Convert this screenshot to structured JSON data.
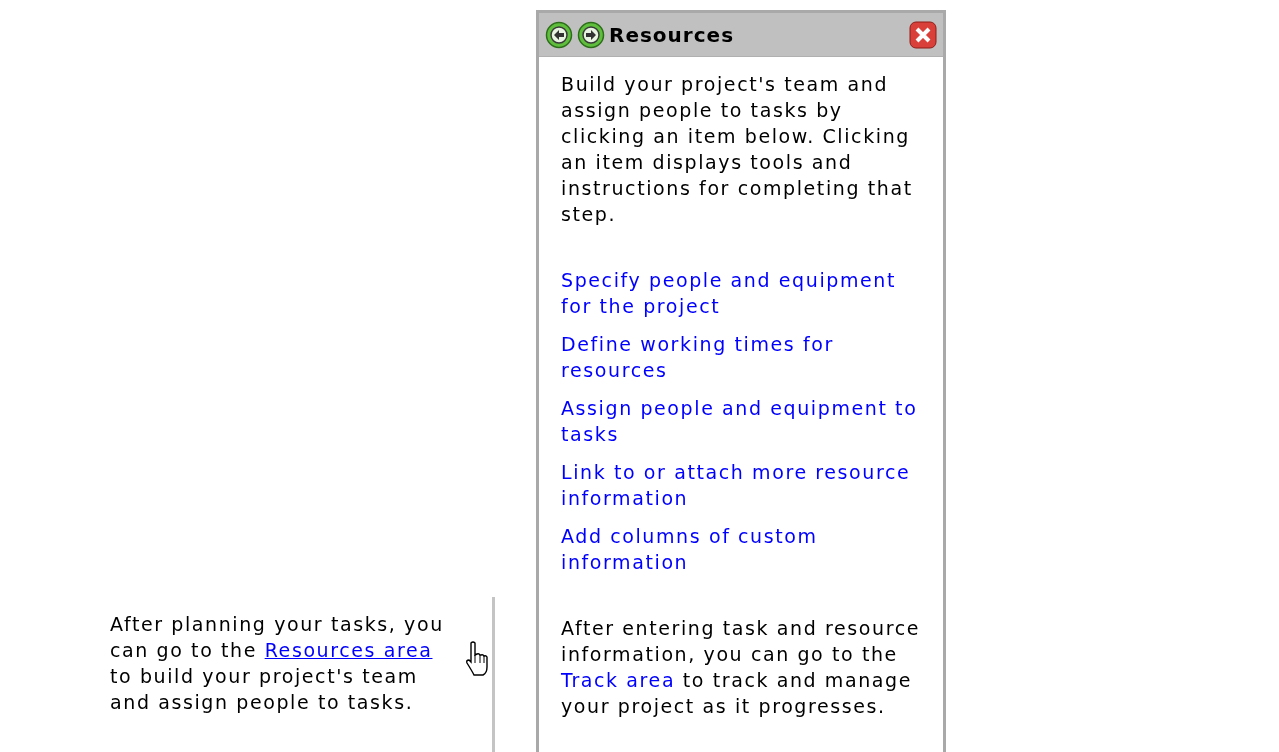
{
  "note": {
    "text_before": "After planning your tasks, you can go to the",
    "link": "Resources area",
    "text_after": "to build your project's team and assign people to tasks."
  },
  "panel": {
    "title": "Resources",
    "intro": "Build your project's team and assign people to tasks by clicking an item below. Clicking an item displays tools and instructions for completing that step.",
    "links": [
      "Specify people and equipment for the project",
      "Define working times for resources",
      "Assign people and equipment to tasks",
      "Link to or attach more resource information",
      "Add columns of custom information"
    ],
    "footer": {
      "text_before": "After entering task and resource information, you can go to the",
      "link": "Track area",
      "text_after": "to track and manage your project as it progresses."
    }
  }
}
